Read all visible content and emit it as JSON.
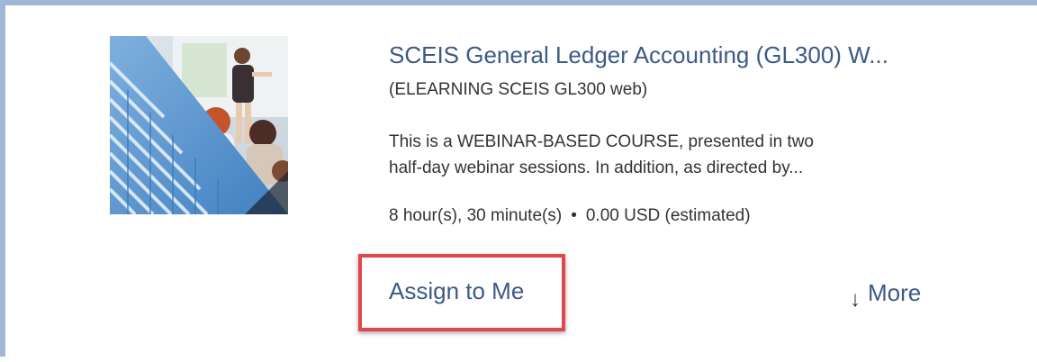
{
  "course": {
    "title": "SCEIS General Ledger Accounting (GL300) W...",
    "subtitle": "(ELEARNING SCEIS GL300 web)",
    "description_lines": [
      "This is a WEBINAR-BASED COURSE, presented in two",
      "half-day webinar sessions. In addition, as directed by..."
    ],
    "duration": "8 hour(s), 30 minute(s)",
    "separator": "•",
    "price": "0.00 USD (estimated)",
    "thumbnail_icon": "classroom-keyboard-image"
  },
  "actions": {
    "assign_label": "Assign to Me",
    "more_label": "More",
    "more_icon": "arrow-down-icon"
  },
  "colors": {
    "link": "#3c5a86",
    "text": "#333333",
    "highlight": "#e0474c",
    "frame": "#9fb8d8"
  }
}
